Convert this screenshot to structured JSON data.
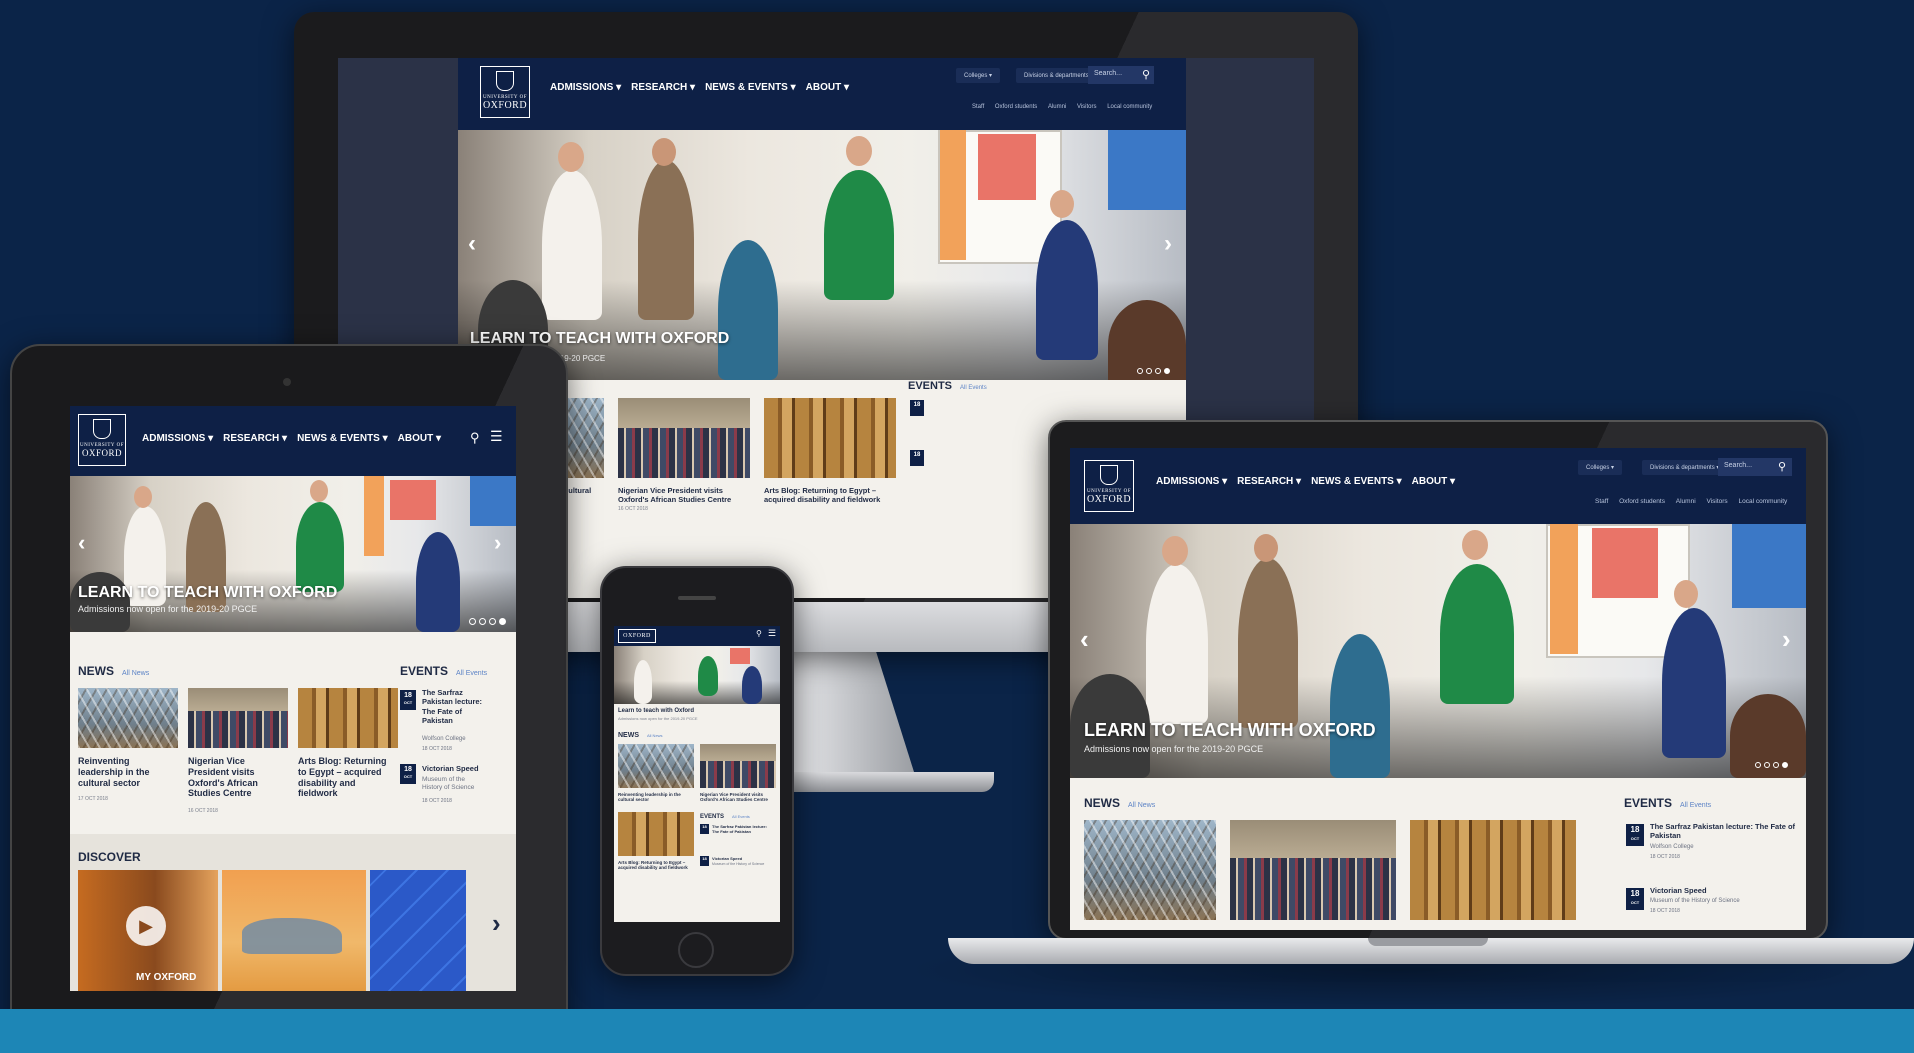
{
  "site": {
    "logo": {
      "line1": "UNIVERSITY OF",
      "line2": "OXFORD"
    },
    "nav": [
      "ADMISSIONS ▾",
      "RESEARCH ▾",
      "NEWS & EVENTS ▾",
      "ABOUT ▾"
    ],
    "colleges_label": "Colleges ▾",
    "divisions_label": "Divisions & departments ▾",
    "search_placeholder": "Search...",
    "quick_links": [
      "Staff",
      "Oxford students",
      "Alumni",
      "Visitors",
      "Local community"
    ]
  },
  "hero": {
    "title": "LEARN TO TEACH WITH OXFORD",
    "subtitle": "Admissions now open for the 2019-20 PGCE",
    "subtitle_partial": "for the 2019-20 PGCE"
  },
  "news": {
    "heading": "NEWS",
    "all_link": "All News",
    "items": [
      {
        "title": "Reinventing leadership in the cultural sector",
        "date": "17 OCT 2018"
      },
      {
        "title": "Nigerian Vice President visits Oxford's African Studies Centre",
        "date": "16 OCT 2018"
      },
      {
        "title": "Arts Blog: Returning to Egypt – acquired disability and fieldwork",
        "date": ""
      }
    ],
    "partial_title": "in the cultural"
  },
  "events": {
    "heading": "EVENTS",
    "all_link": "All Events",
    "items": [
      {
        "day": "18",
        "month": "OCT",
        "title": "The Sarfraz Pakistan lecture: The Fate of Pakistan",
        "venue": "Wolfson College",
        "date": "18 OCT 2018"
      },
      {
        "day": "18",
        "month": "OCT",
        "title": "Victorian Speed",
        "venue": "Museum of the History of Science",
        "date": "18 OCT 2018"
      }
    ]
  },
  "discover": {
    "heading": "DISCOVER",
    "caption": "MY OXFORD"
  },
  "phone": {
    "hero_title": "Learn to teach with Oxford",
    "hero_sub": "Admissions now open for the 2019-20 PGCE"
  },
  "icons": {
    "search": "search-icon",
    "menu": "menu-icon",
    "prev": "chevron-left-icon",
    "next": "chevron-right-icon",
    "play": "play-icon"
  },
  "colors": {
    "navy": "#0e2046",
    "background": "#0b2448",
    "stripe": "#1d86b6",
    "link": "#5d84c6"
  }
}
